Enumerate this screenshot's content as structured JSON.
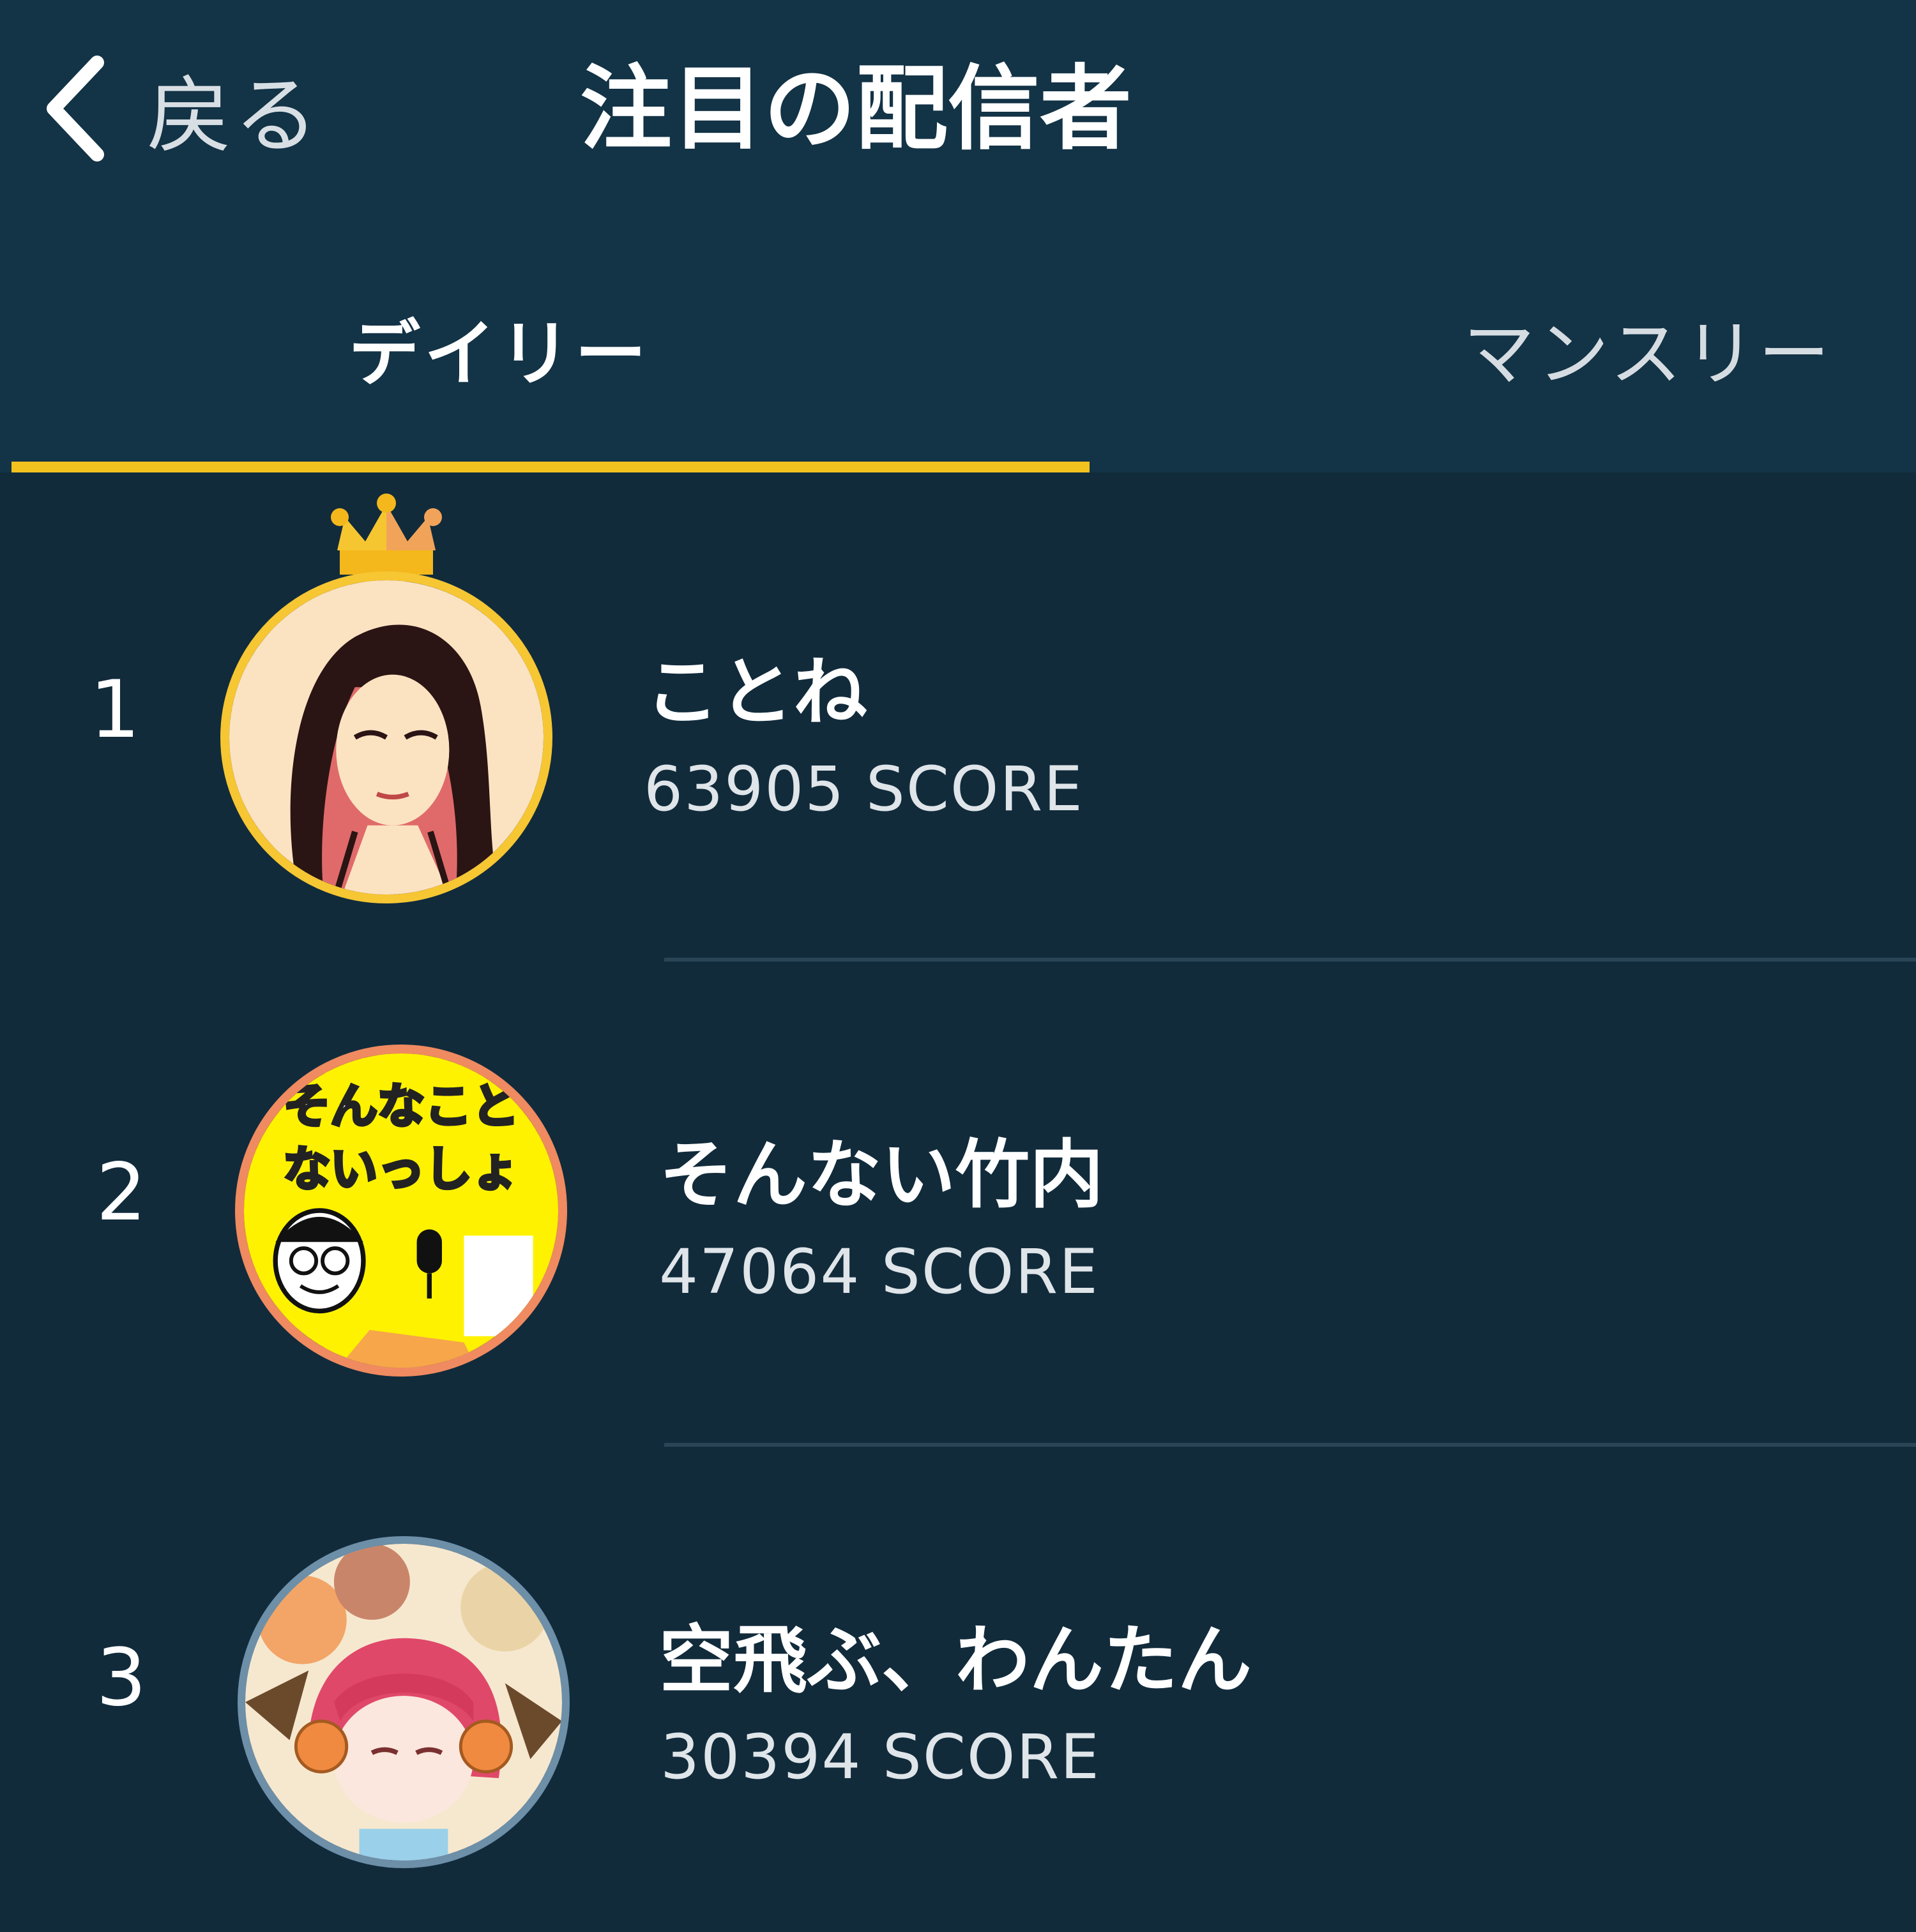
{
  "header": {
    "back_label": "戻る",
    "title": "注目の配信者"
  },
  "tabs": [
    {
      "label": "デイリー",
      "active": true
    },
    {
      "label": "マンスリー",
      "active": false
    }
  ],
  "ranking": [
    {
      "rank": "1",
      "name": "ことね",
      "score": "63905 SCORE",
      "badge": "crown-icon"
    },
    {
      "rank": "2",
      "name": "そんない竹内",
      "score": "47064 SCORE",
      "avatar_text_line1": "そんなこと",
      "avatar_text_line2": "ないっしょ"
    },
    {
      "rank": "3",
      "name": "空飛ぶ、わんたん",
      "score": "30394 SCORE"
    }
  ],
  "colors": {
    "background": "#112b3b",
    "header": "#133346",
    "accent": "#f4c21e",
    "divider": "#2a4556"
  }
}
